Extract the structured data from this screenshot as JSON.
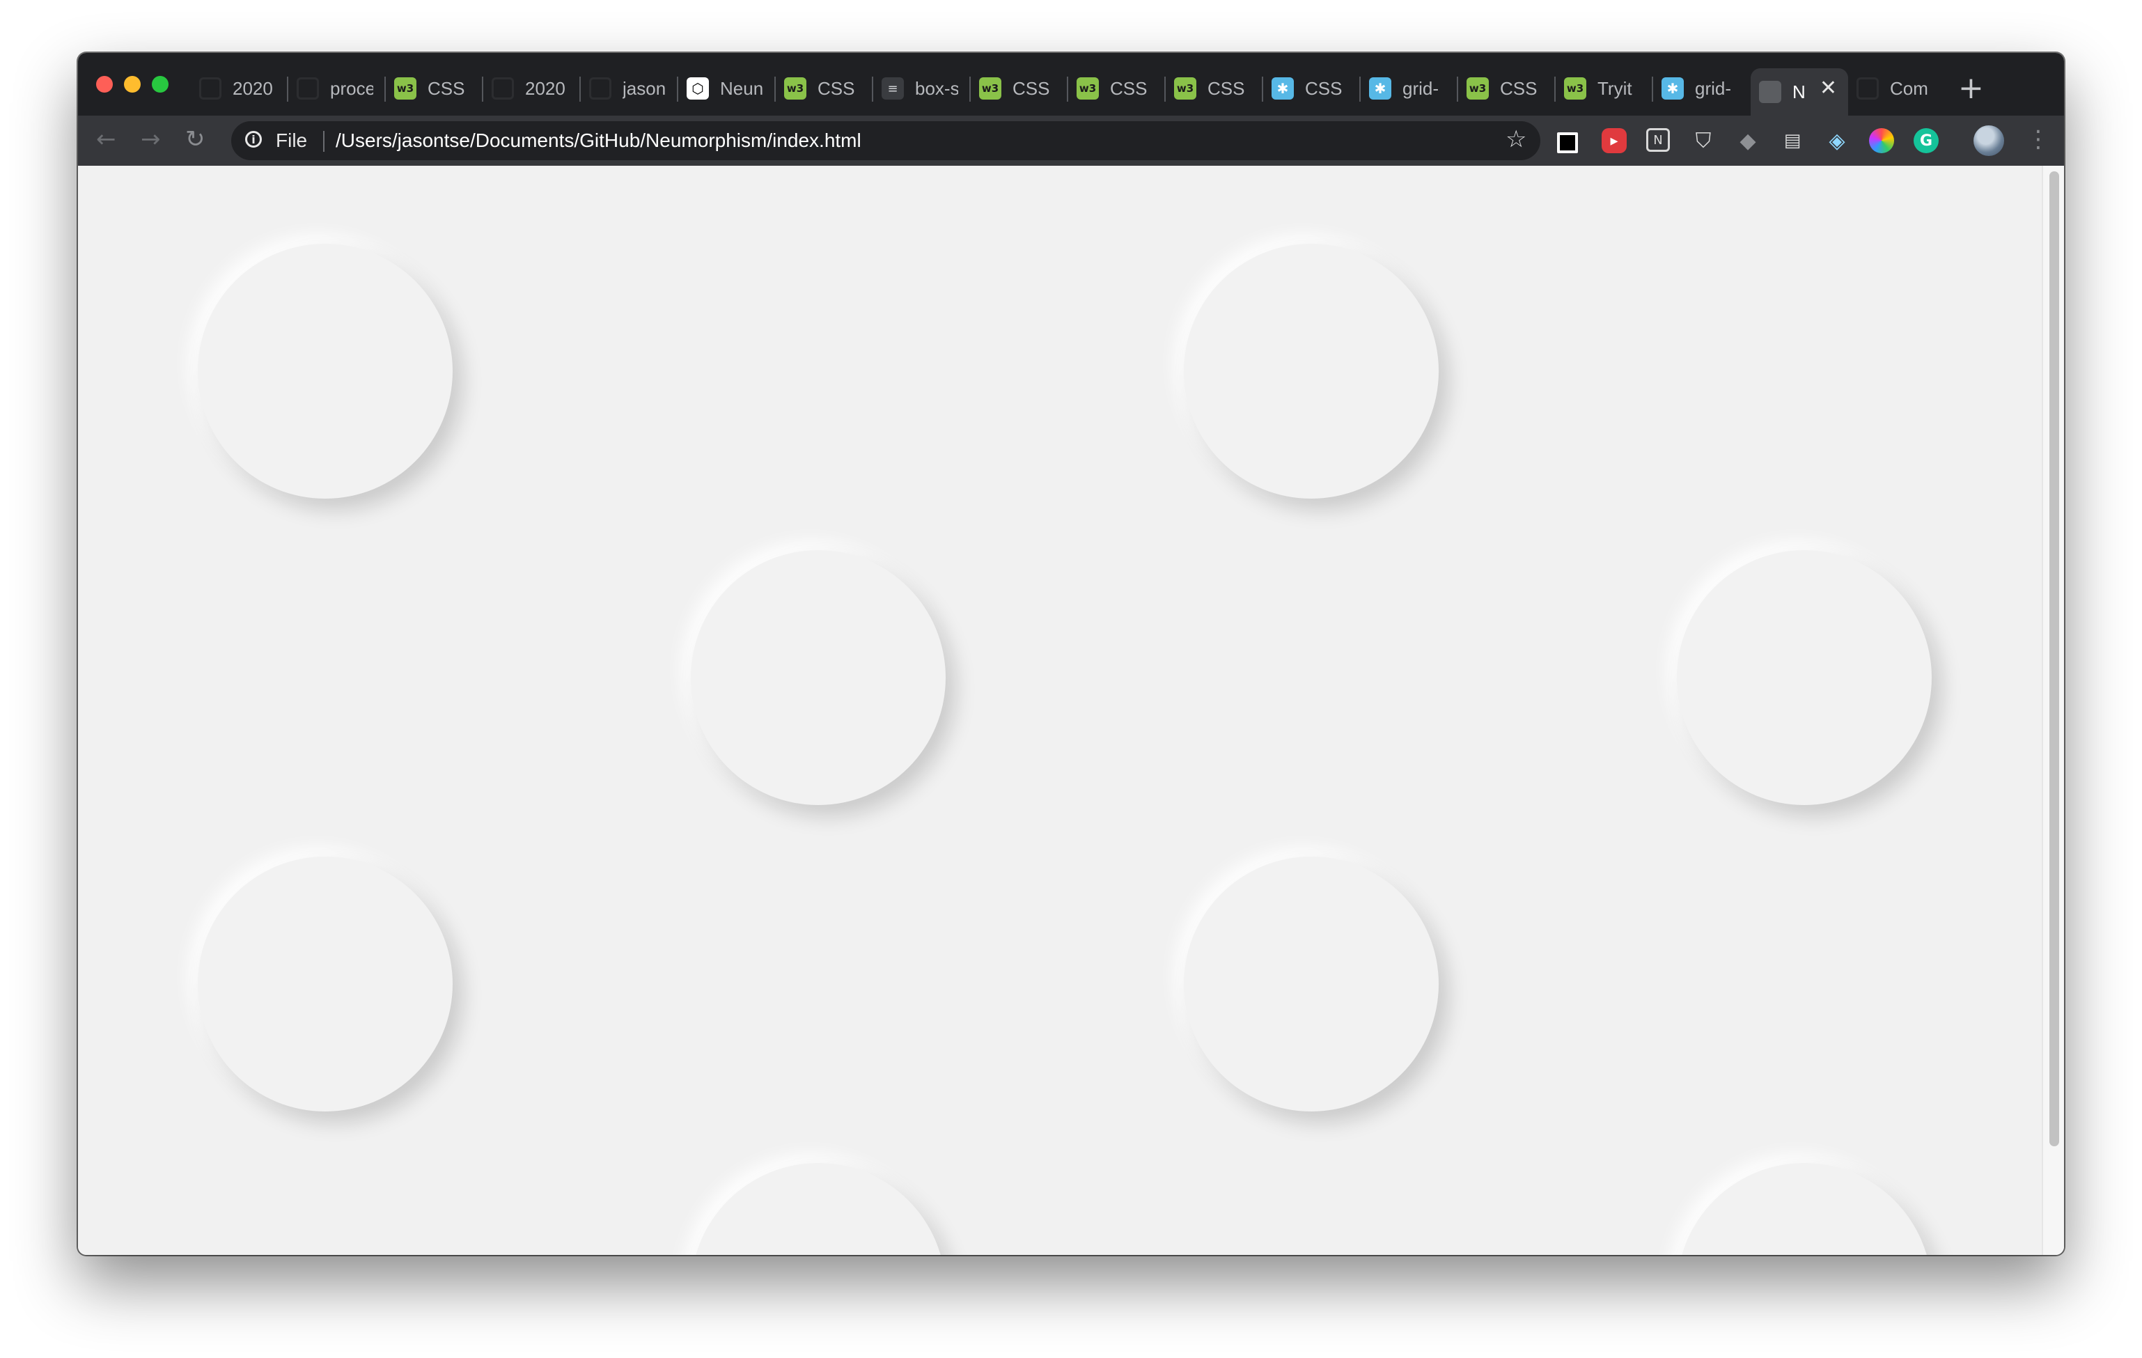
{
  "browser": {
    "tabs": [
      {
        "label": "2020",
        "icon": "github-icon"
      },
      {
        "label": "proce",
        "icon": "github-icon"
      },
      {
        "label": "CSS",
        "icon": "w3schools-icon"
      },
      {
        "label": "2020",
        "icon": "github-icon"
      },
      {
        "label": "jason",
        "icon": "github-icon"
      },
      {
        "label": "Neun",
        "icon": "codepen-icon"
      },
      {
        "label": "CSS",
        "icon": "w3schools-icon"
      },
      {
        "label": "box-s",
        "icon": "box-shadow-icon"
      },
      {
        "label": "CSS",
        "icon": "w3schools-icon"
      },
      {
        "label": "CSS",
        "icon": "w3schools-icon"
      },
      {
        "label": "CSS",
        "icon": "w3schools-icon"
      },
      {
        "label": "CSS",
        "icon": "css-tricks-icon"
      },
      {
        "label": "grid-",
        "icon": "css-tricks-icon"
      },
      {
        "label": "CSS",
        "icon": "w3schools-icon"
      },
      {
        "label": "Tryit",
        "icon": "w3schools-icon"
      },
      {
        "label": "grid-",
        "icon": "css-tricks-icon"
      },
      {
        "label": "N",
        "icon": "globe-icon",
        "active": true
      },
      {
        "label": "Com",
        "icon": "github-icon"
      }
    ],
    "address_bar": {
      "scheme": "File",
      "url": "/Users/jasontse/Documents/GitHub/Neumorphism/index.html"
    }
  },
  "colors": {
    "page_background": "#f1f1f1",
    "tab_strip": "#1f2023",
    "toolbar": "#36373b"
  }
}
